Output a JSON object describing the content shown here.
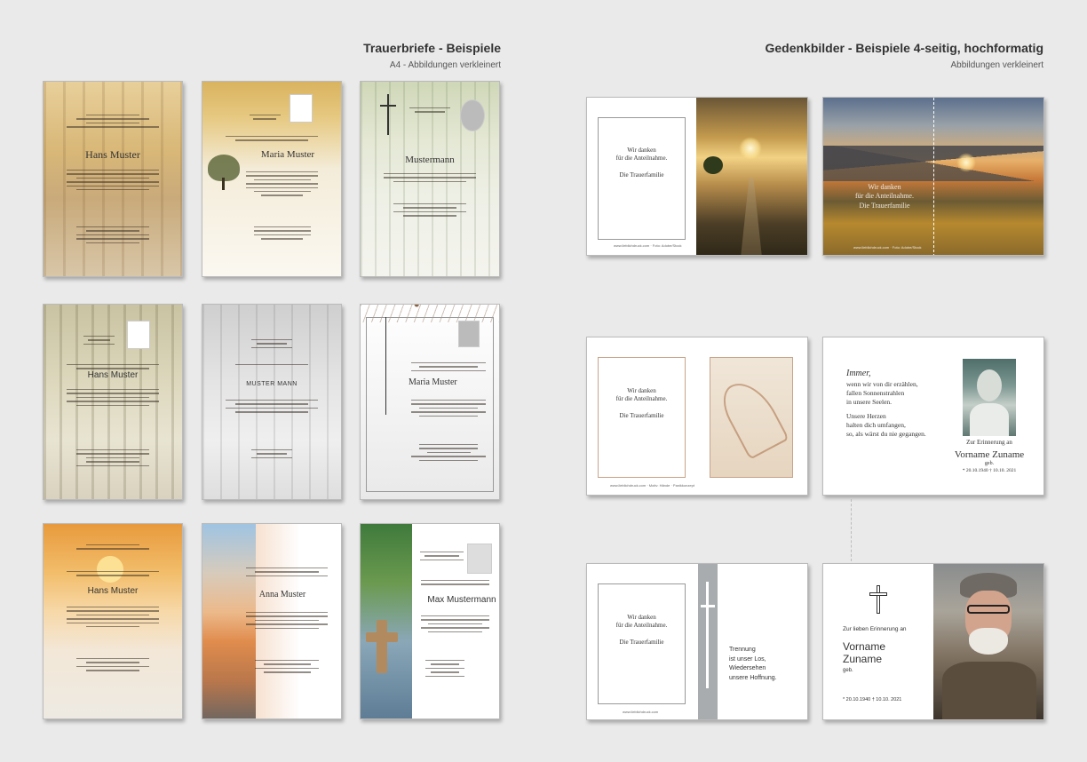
{
  "left_heading": {
    "title": "Trauerbriefe - Beispiele",
    "subtitle": "A4 - Abbildungen verkleinert"
  },
  "right_heading": {
    "title": "Gedenkbilder - Beispiele 4-seitig, hochformatig",
    "subtitle": "Abbildungen verkleinert"
  },
  "letters": {
    "hans1": "Hans Muster",
    "maria1": "Maria Muster",
    "mustermann1": "Mustermann",
    "hans2": "Hans Muster",
    "mustermann2": "MUSTER MANN",
    "maria2": "Maria Muster",
    "hans3": "Hans Muster",
    "anna": "Anna Muster",
    "max": "Max Mustermann"
  },
  "gedenk1": {
    "thanks1": "Wir danken",
    "thanks2": "für die Anteilnahme.",
    "family": "Die Trauerfamilie",
    "footer": "www.lieblichdruck.com · Foto: Adobe/Stock"
  },
  "gedenk2": {
    "thanks1": "Wir danken",
    "thanks2": "für die Anteilnahme.",
    "family": "Die Trauerfamilie",
    "footer": "www.lieblichdruck.com · Foto: Adobe/Stock"
  },
  "gedenk3": {
    "thanks1": "Wir danken",
    "thanks2": "für die Anteilnahme.",
    "family": "Die Trauerfamilie",
    "footer": "www.lieblichdruck.com · Motiv: Hände · Panikkonzept",
    "poem_lines": [
      "Immer,",
      "wenn wir von dir erzählen,",
      "fallen Sonnenstrahlen",
      "in unsere Seelen.",
      "",
      "Unsere Herzen",
      "halten dich umfangen,",
      "so, als wärst du nie gegangen."
    ],
    "memory": "Zur Erinnerung an",
    "name": "Vorname Zuname",
    "born": "geb.",
    "dates": "* 20.10.1940   † 10.10. 2021"
  },
  "gedenk4": {
    "thanks1": "Wir danken",
    "thanks2": "für die Anteilnahme.",
    "family": "Die Trauerfamilie",
    "footer": "www.lieblichdruck.com",
    "poem_lines": [
      "Trennung",
      "ist unser Los,",
      "Wiedersehen",
      "unsere Hoffnung."
    ],
    "memory": "Zur lieben Erinnerung an",
    "first": "Vorname",
    "last": "Zuname",
    "born": "geb.",
    "dates": "* 20.10.1940   † 10.10. 2021"
  }
}
